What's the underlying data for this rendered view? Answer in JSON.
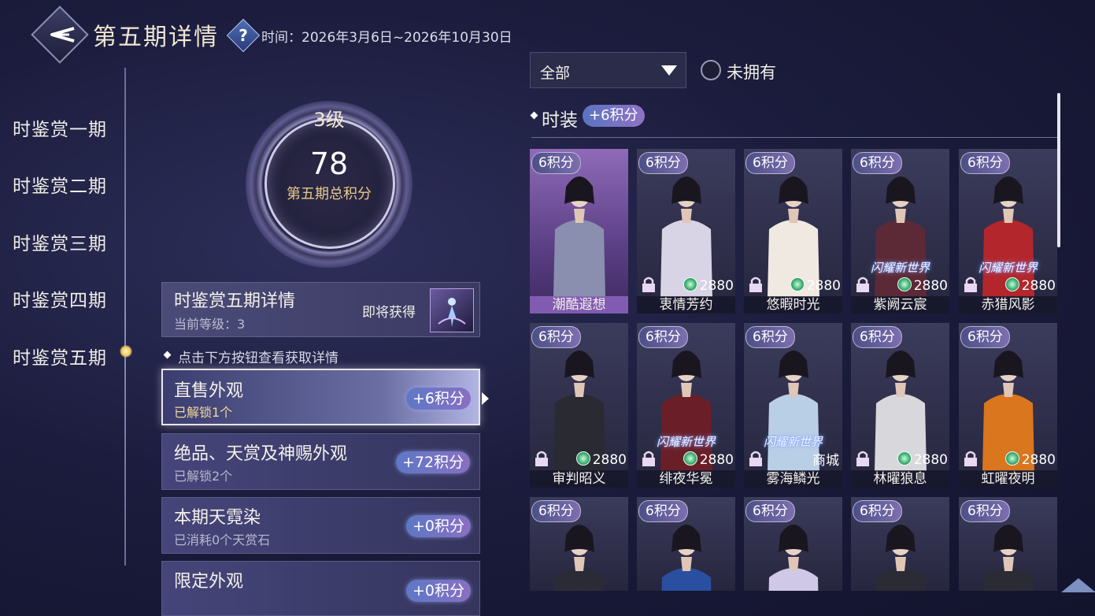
{
  "header": {
    "title": "第五期详情",
    "help_symbol": "?",
    "time_label": "时间：2026年3月6日~2026年10月30日"
  },
  "nav": {
    "items": [
      {
        "label": "时鉴赏一期"
      },
      {
        "label": "时鉴赏二期"
      },
      {
        "label": "时鉴赏三期"
      },
      {
        "label": "时鉴赏四期"
      },
      {
        "label": "时鉴赏五期",
        "active": true
      }
    ]
  },
  "score": {
    "level": "3级",
    "value": "78",
    "label": "第五期总积分"
  },
  "detail": {
    "title": "时鉴赏五期详情",
    "current_level": "当前等级：3",
    "soon_label": "即将获得"
  },
  "hint": "点击下方按钮查看获取详情",
  "categories": [
    {
      "title": "直售外观",
      "sub": "已解锁1个",
      "points": "+6积分",
      "active": true
    },
    {
      "title": "绝品、天赏及神赐外观",
      "sub": "已解锁2个",
      "points": "+72积分"
    },
    {
      "title": "本期天霓染",
      "sub": "已消耗0个天赏石",
      "points": "+0积分"
    },
    {
      "title": "限定外观",
      "sub": "",
      "points": "+0积分"
    }
  ],
  "filter": {
    "value": "全部",
    "unowned_label": "未拥有"
  },
  "section": {
    "title": "时装",
    "points": "+6积分"
  },
  "cards": [
    {
      "badge": "6积分",
      "name": "潮酷遐想",
      "owned": true,
      "price": "",
      "tag": "",
      "shop": "",
      "accent": "#8a8fb0"
    },
    {
      "badge": "6积分",
      "name": "衷情芳约",
      "price": "2880",
      "tag": "",
      "shop": "",
      "accent": "#d9d3e6"
    },
    {
      "badge": "6积分",
      "name": "悠暇时光",
      "price": "2880",
      "tag": "",
      "shop": "",
      "accent": "#efe9e2"
    },
    {
      "badge": "6积分",
      "name": "紫阙云宸",
      "price": "2880",
      "tag": "闪耀新世界",
      "shop": "",
      "accent": "#5c2a36"
    },
    {
      "badge": "6积分",
      "name": "赤猎风影",
      "price": "2880",
      "tag": "闪耀新世界",
      "shop": "",
      "accent": "#b3262c"
    },
    {
      "badge": "6积分",
      "name": "审判昭义",
      "price": "2880",
      "tag": "",
      "shop": "",
      "accent": "#2a2a32"
    },
    {
      "badge": "6积分",
      "name": "绯夜华冕",
      "price": "2880",
      "tag": "闪耀新世界",
      "shop": "",
      "accent": "#6a1f28"
    },
    {
      "badge": "6积分",
      "name": "雾海鳞光",
      "price": "",
      "tag": "闪耀新世界",
      "shop": "商城",
      "accent": "#b9cfe6"
    },
    {
      "badge": "6积分",
      "name": "林曜狼息",
      "price": "2880",
      "tag": "",
      "shop": "",
      "accent": "#d8d8dc"
    },
    {
      "badge": "6积分",
      "name": "虹曜夜明",
      "price": "2880",
      "tag": "",
      "shop": "",
      "accent": "#d9761e"
    },
    {
      "badge": "6积分",
      "name": "",
      "price": "",
      "tag": "",
      "shop": "",
      "accent": "#2b2b36"
    },
    {
      "badge": "6积分",
      "name": "",
      "price": "",
      "tag": "",
      "shop": "",
      "accent": "#2a4fa0"
    },
    {
      "badge": "6积分",
      "name": "",
      "price": "",
      "tag": "",
      "shop": "",
      "accent": "#cfc8e6"
    },
    {
      "badge": "6积分",
      "name": "",
      "price": "",
      "tag": "",
      "shop": "",
      "accent": "#2b2b36"
    },
    {
      "badge": "6积分",
      "name": "",
      "price": "",
      "tag": "",
      "shop": "",
      "accent": "#2b2b36"
    }
  ]
}
